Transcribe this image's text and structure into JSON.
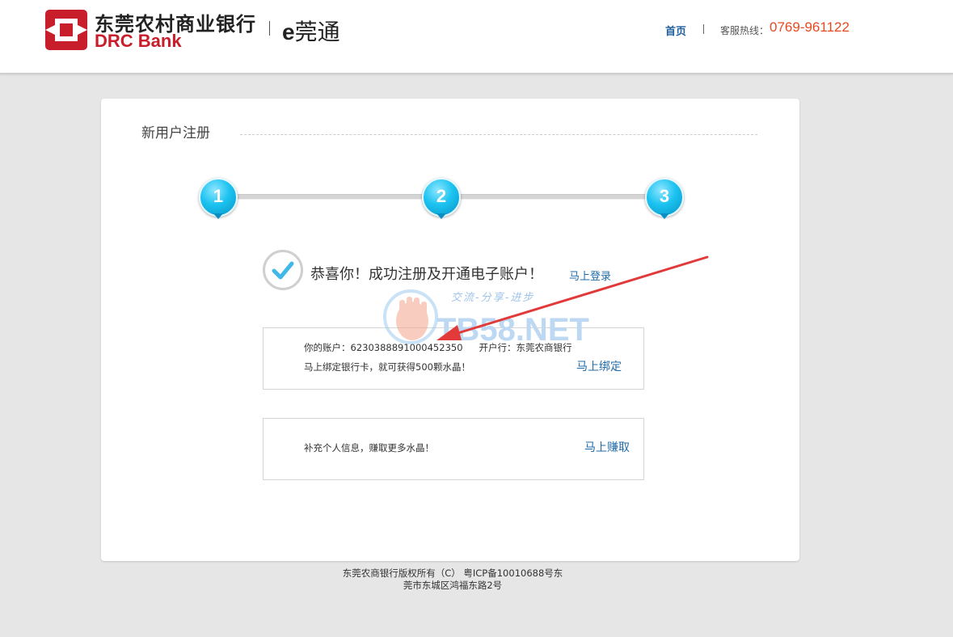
{
  "header": {
    "brand_cn": "东莞农村商业银行",
    "brand_en": "DRC Bank",
    "product_prefix": "e",
    "product_name": "莞通",
    "nav_home": "首页",
    "hotline_label": "客服热线：",
    "hotline_number": "0769-961122",
    "colors": {
      "brand_red": "#c81e2c",
      "hotline": "#e64a21",
      "link": "#1f6aa8"
    }
  },
  "panel": {
    "title": "新用户注册",
    "steps": [
      {
        "number": "1"
      },
      {
        "number": "2"
      },
      {
        "number": "3"
      }
    ],
    "success_message": "恭喜你！成功注册及开通电子账户！",
    "login_link": "马上登录",
    "account_box": {
      "account_label": "你的账户：",
      "account_number": "6230388891000452350",
      "bank_label": "开户行：",
      "bank_name": "东莞农商银行",
      "bind_hint": "马上绑定银行卡，就可获得500颗水晶！",
      "bind_link": "马上绑定"
    },
    "profile_box": {
      "hint": "补充个人信息，赚取更多水晶！",
      "earn_link": "马上赚取"
    }
  },
  "watermark": {
    "slogan": "交流-分享-进步",
    "site": "TB58.NET"
  },
  "footer": {
    "line1": "东莞农商银行版权所有（C） 粤ICP备10010688号东",
    "line2": "莞市东城区鸿福东路2号"
  }
}
